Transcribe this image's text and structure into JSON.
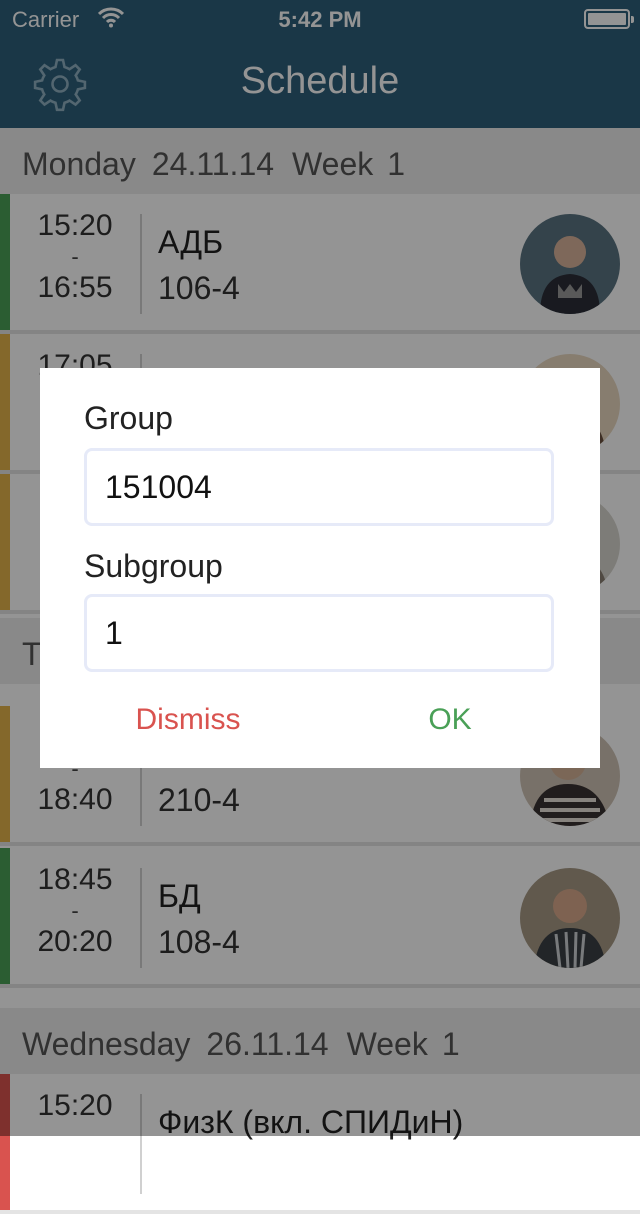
{
  "status_bar": {
    "carrier": "Carrier",
    "time": "5:42 PM"
  },
  "nav": {
    "title": "Schedule",
    "settings_icon": "gear-icon"
  },
  "days": [
    {
      "name": "Monday",
      "date": "24.11.14",
      "week_label": "Week",
      "week": "1"
    },
    {
      "name": "Wednesday",
      "date": "26.11.14",
      "week_label": "Week",
      "week": "1"
    }
  ],
  "partial_day_initial": "T",
  "lessons": [
    {
      "start": "15:20",
      "dash": "-",
      "end": "16:55",
      "subject": "АДБ",
      "room": "106-4",
      "bar_color": "#4aa057",
      "avatar": "teacher-photo"
    },
    {
      "start": "17:05",
      "dash": "-",
      "end": "",
      "subject": "",
      "room": "",
      "bar_color": "#e3b34a",
      "avatar": "teacher-photo"
    },
    {
      "start": "",
      "dash": "",
      "end": "",
      "subject": "",
      "room": "",
      "bar_color": "#e3b34a",
      "avatar": "teacher-photo"
    },
    {
      "start": "",
      "dash": "-",
      "end": "18:40",
      "subject": "",
      "room": "210-4",
      "bar_color": "#e3b34a",
      "avatar": "teacher-photo"
    },
    {
      "start": "18:45",
      "dash": "-",
      "end": "20:20",
      "subject": "БД",
      "room": "108-4",
      "bar_color": "#4aa057",
      "avatar": "teacher-photo"
    },
    {
      "start": "15:20",
      "dash": "",
      "end": "",
      "subject": "ФизК (вкл. СПИДиН)",
      "room": "",
      "bar_color": "#d9534f",
      "avatar": ""
    }
  ],
  "dialog": {
    "group_label": "Group",
    "group_value": "151004",
    "subgroup_label": "Subgroup",
    "subgroup_value": "1",
    "dismiss_label": "Dismiss",
    "ok_label": "OK",
    "dismiss_color": "#d9534f",
    "ok_color": "#4aa057"
  }
}
